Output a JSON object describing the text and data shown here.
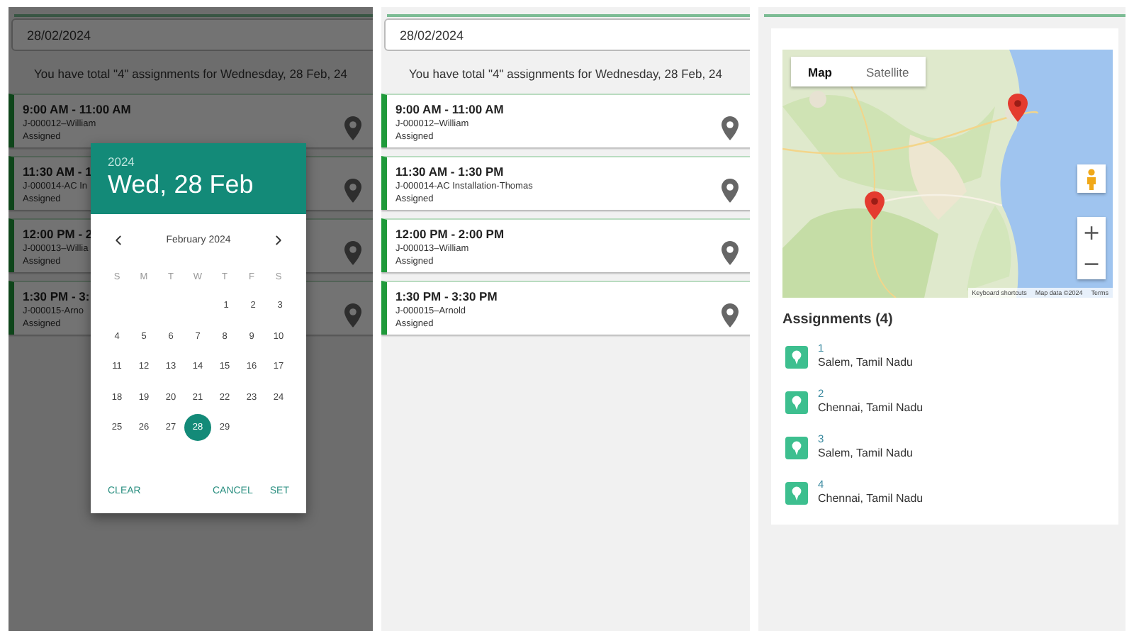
{
  "list_screen_dimmed": {
    "date_field": {
      "value": "28/02/2024"
    },
    "summary": "You have total \"4\" assignments for Wednesday, 28 Feb, 24",
    "cards": [
      {
        "time": "9:00 AM - 11:00 AM",
        "job": "J-000012–William",
        "status": "Assigned"
      },
      {
        "time": "11:30 AM - 1",
        "job": "J-000014-AC In",
        "status": "Assigned"
      },
      {
        "time": "12:00 PM - 2",
        "job": "J-000013–Willia",
        "status": "Assigned"
      },
      {
        "time": "1:30 PM - 3:",
        "job": "J-000015-Arno",
        "status": "Assigned"
      }
    ]
  },
  "date_picker": {
    "year": "2024",
    "date_title": "Wed, 28 Feb",
    "month_label": "February 2024",
    "weekdays": [
      "S",
      "M",
      "T",
      "W",
      "T",
      "F",
      "S"
    ],
    "weeks": [
      {
        "days": [
          {
            "label": "1",
            "selected": false
          },
          {
            "label": "2",
            "selected": false
          },
          {
            "label": "3",
            "selected": false
          }
        ]
      },
      {
        "days": [
          {
            "label": "4",
            "selected": false
          },
          {
            "label": "5",
            "selected": false
          },
          {
            "label": "6",
            "selected": false
          },
          {
            "label": "7",
            "selected": false
          },
          {
            "label": "8",
            "selected": false
          },
          {
            "label": "9",
            "selected": false
          },
          {
            "label": "10",
            "selected": false
          }
        ]
      },
      {
        "days": [
          {
            "label": "11",
            "selected": false
          },
          {
            "label": "12",
            "selected": false
          },
          {
            "label": "13",
            "selected": false
          },
          {
            "label": "14",
            "selected": false
          },
          {
            "label": "15",
            "selected": false
          },
          {
            "label": "16",
            "selected": false
          },
          {
            "label": "17",
            "selected": false
          }
        ]
      },
      {
        "days": [
          {
            "label": "18",
            "selected": false
          },
          {
            "label": "19",
            "selected": false
          },
          {
            "label": "20",
            "selected": false
          },
          {
            "label": "21",
            "selected": false
          },
          {
            "label": "22",
            "selected": false
          },
          {
            "label": "23",
            "selected": false
          },
          {
            "label": "24",
            "selected": false
          }
        ]
      },
      {
        "days": [
          {
            "label": "25",
            "selected": false
          },
          {
            "label": "26",
            "selected": false
          },
          {
            "label": "27",
            "selected": false
          },
          {
            "label": "28",
            "selected": true
          },
          {
            "label": "29",
            "selected": false
          }
        ]
      }
    ],
    "buttons": [
      "CLEAR",
      "CANCEL",
      "SET"
    ]
  },
  "list_screen": {
    "date_field": {
      "value": "28/02/2024"
    },
    "summary": "You have total \"4\" assignments for Wednesday, 28 Feb, 24",
    "cards": [
      {
        "time": "9:00 AM - 11:00 AM",
        "job": "J-000012–William",
        "status": "Assigned"
      },
      {
        "time": "11:30 AM - 1:30 PM",
        "job": "J-000014-AC Installation-Thomas",
        "status": "Assigned"
      },
      {
        "time": "12:00 PM - 2:00 PM",
        "job": "J-000013–William",
        "status": "Assigned"
      },
      {
        "time": "1:30 PM - 3:30 PM",
        "job": "J-000015–Arnold",
        "status": "Assigned"
      }
    ]
  },
  "map_screen": {
    "map": {
      "tabs": [
        {
          "label": "Map",
          "selected": true
        },
        {
          "label": "Satellite",
          "selected": false
        }
      ],
      "zoom_buttons": [
        "+",
        "−"
      ],
      "attribution": [
        "Keyboard shortcuts",
        "Map data ©2024",
        "Terms"
      ]
    },
    "assignments_title": "Assignments (4)",
    "assignments": [
      {
        "number": "1",
        "address": "Salem, Tamil Nadu"
      },
      {
        "number": "2",
        "address": "Chennai, Tamil Nadu"
      },
      {
        "number": "3",
        "address": "Salem, Tamil Nadu"
      },
      {
        "number": "4",
        "address": "Chennai, Tamil Nadu"
      }
    ]
  }
}
